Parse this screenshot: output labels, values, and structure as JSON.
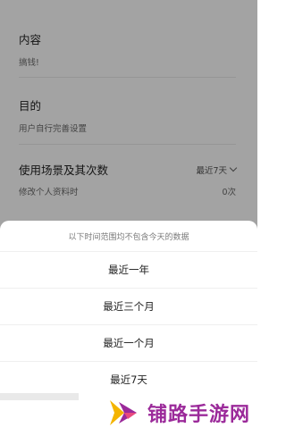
{
  "form": {
    "content": {
      "label": "内容",
      "value": "搞钱!"
    },
    "purpose": {
      "label": "目的",
      "value": "用户自行完善设置"
    },
    "usage": {
      "label": "使用场景及其次数",
      "select_value": "最近7天",
      "scene": "修改个人资料时",
      "count": "0次"
    }
  },
  "sheet": {
    "hint": "以下时间范围均不包含今天的数据",
    "options": [
      "最近一年",
      "最近三个月",
      "最近一个月",
      "最近7天"
    ]
  },
  "watermark": {
    "text": "铺路手游网",
    "color": "#9b2a9a"
  }
}
